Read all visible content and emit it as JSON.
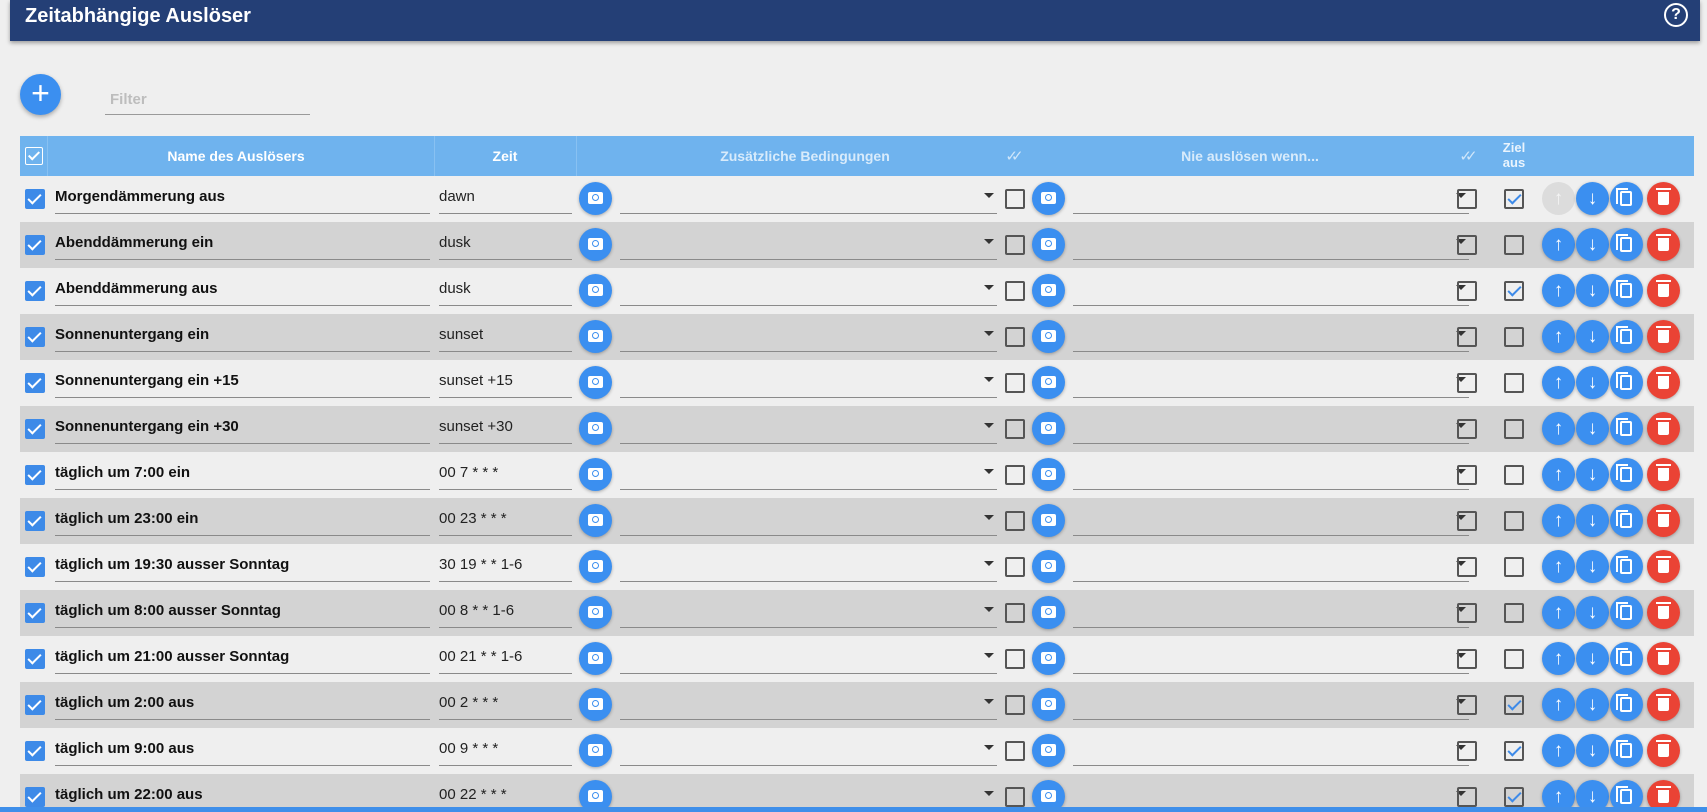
{
  "header": {
    "title": "Zeitabhängige Auslöser",
    "help_icon": "help-circle-icon"
  },
  "toolbar": {
    "add_icon": "plus-icon",
    "filter_placeholder": "Filter",
    "filter_value": ""
  },
  "table": {
    "columns": {
      "name": "Name des Auslösers",
      "zeit": "Zeit",
      "conditions": "Zusätzliche Bedingungen",
      "never": "Nie auslösen wenn...",
      "ziel": "Ziel aus"
    },
    "rows": [
      {
        "enabled": true,
        "name": "Morgendämmerung aus",
        "zeit": "dawn",
        "cond_check": false,
        "ziel_aus": true,
        "up_disabled": true
      },
      {
        "enabled": true,
        "name": "Abenddämmerung ein",
        "zeit": "dusk",
        "cond_check": false,
        "ziel_aus": false,
        "up_disabled": false
      },
      {
        "enabled": true,
        "name": "Abenddämmerung aus",
        "zeit": "dusk",
        "cond_check": false,
        "ziel_aus": true,
        "up_disabled": false
      },
      {
        "enabled": true,
        "name": "Sonnenuntergang ein",
        "zeit": "sunset",
        "cond_check": false,
        "ziel_aus": false,
        "up_disabled": false
      },
      {
        "enabled": true,
        "name": "Sonnenuntergang ein +15",
        "zeit": "sunset +15",
        "cond_check": false,
        "ziel_aus": false,
        "up_disabled": false
      },
      {
        "enabled": true,
        "name": "Sonnenuntergang ein +30",
        "zeit": "sunset +30",
        "cond_check": false,
        "ziel_aus": false,
        "up_disabled": false
      },
      {
        "enabled": true,
        "name": "täglich um 7:00 ein",
        "zeit": "00 7 * * *",
        "cond_check": false,
        "ziel_aus": false,
        "up_disabled": false
      },
      {
        "enabled": true,
        "name": "täglich um 23:00 ein",
        "zeit": "00 23 * * *",
        "cond_check": false,
        "ziel_aus": false,
        "up_disabled": false
      },
      {
        "enabled": true,
        "name": "täglich um 19:30 ausser Sonntag",
        "zeit": "30 19 * * 1-6",
        "cond_check": false,
        "ziel_aus": false,
        "up_disabled": false
      },
      {
        "enabled": true,
        "name": "täglich um 8:00 ausser Sonntag",
        "zeit": "00 8 * * 1-6",
        "cond_check": false,
        "ziel_aus": false,
        "up_disabled": false
      },
      {
        "enabled": true,
        "name": "täglich um 21:00 ausser Sonntag",
        "zeit": "00 21 * * 1-6",
        "cond_check": false,
        "ziel_aus": false,
        "up_disabled": false
      },
      {
        "enabled": true,
        "name": "täglich um 2:00 aus",
        "zeit": "00 2 * * *",
        "cond_check": false,
        "ziel_aus": true,
        "up_disabled": false
      },
      {
        "enabled": true,
        "name": "täglich um 9:00 aus",
        "zeit": "00 9 * * *",
        "cond_check": false,
        "ziel_aus": true,
        "up_disabled": false
      },
      {
        "enabled": true,
        "name": "täglich um 22:00 aus",
        "zeit": "00 22 * * *",
        "cond_check": false,
        "ziel_aus": true,
        "up_disabled": false
      }
    ]
  },
  "colors": {
    "header_bg": "#243f76",
    "table_header": "#6fb3ee",
    "accent": "#3b8ff0",
    "delete": "#ea4335"
  }
}
